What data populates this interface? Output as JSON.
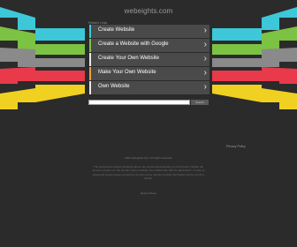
{
  "domain": "webeights.com",
  "related_heading": "Related Links",
  "links": [
    {
      "label": "Create Website",
      "accent": "#3cc8d8"
    },
    {
      "label": "Create a Website with Google",
      "accent": "#7cc243"
    },
    {
      "label": "Create Your Own Website",
      "accent": "#e8e8e8"
    },
    {
      "label": "Make Your Own Website",
      "accent": "#e8a23a"
    },
    {
      "label": "Own Website",
      "accent": "#e8e8e8"
    }
  ],
  "link_chevron": "›",
  "search": {
    "placeholder": "",
    "button_label": "Search"
  },
  "privacy_link": "Privacy Policy",
  "copyright": "2024 webeights.com. All rights reserved.",
  "disclaimer": "The Sponsored Listings displayed above are served automatically by a third party. Neither the service provider nor the domain owner maintain any relationship with the advertisers. In case of trademark issues please contact the domain owner directly (contact information can be found in whois).",
  "report_link": "Report Abuse",
  "colors": {
    "background": "#2b2b2b",
    "cyan": "#3cc8d8",
    "green": "#7cc243",
    "gray": "#8a8a8a",
    "red": "#e83a4a",
    "yellow": "#f0d020"
  }
}
